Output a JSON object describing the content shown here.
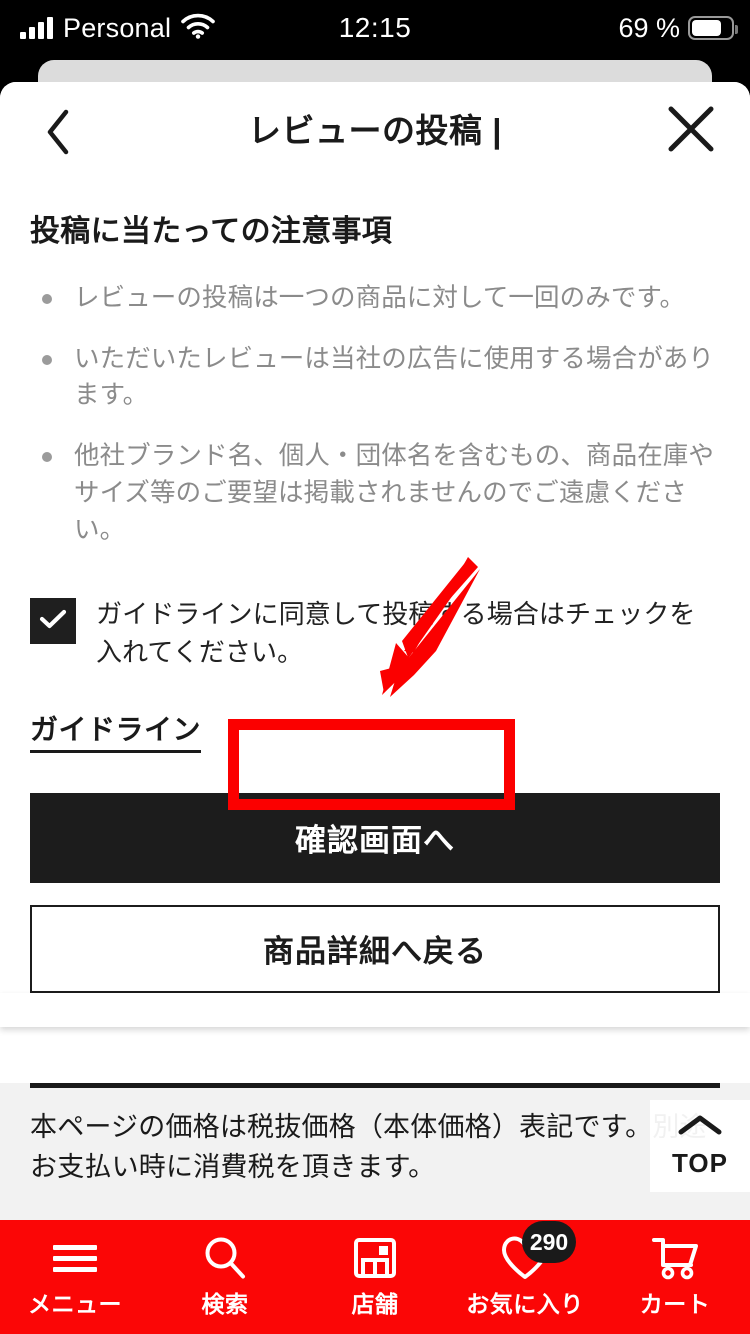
{
  "status_bar": {
    "carrier": "Personal",
    "time": "12:15",
    "battery_percent": "69 %",
    "signal_icon": "signal-bars-icon",
    "wifi_icon": "wifi-icon",
    "battery_icon": "battery-icon"
  },
  "header": {
    "title": "レビューの投稿 |",
    "back_icon": "chevron-left-icon",
    "close_icon": "close-x-icon"
  },
  "main": {
    "section_title": "投稿に当たっての注意事項",
    "notes": [
      "レビューの投稿は一つの商品に対して一回のみです。",
      "いただいたレビューは当社の広告に使用する場合があります。",
      "他社ブランド名、個人・団体名を含むもの、商品在庫やサイズ等のご要望は掲載されませんのでご遠慮ください。"
    ],
    "agreement": {
      "checked": true,
      "check_icon": "checkmark-icon",
      "label": "ガイドラインに同意して投稿する場合はチェックを入れてください。"
    },
    "guideline_link": "ガイドライン",
    "primary_button": "確認画面へ",
    "secondary_button": "商品詳細へ戻る"
  },
  "footer": {
    "note": "本ページの価格は税抜価格（本体価格）表記です。別途お支払い時に消費税を頂きます。",
    "top_button": {
      "label": "TOP",
      "icon": "chevron-up-icon"
    }
  },
  "bottom_nav": [
    {
      "label": "メニュー",
      "icon": "hamburger-menu-icon",
      "badge": null
    },
    {
      "label": "検索",
      "icon": "search-icon",
      "badge": null
    },
    {
      "label": "店舗",
      "icon": "store-icon",
      "badge": null
    },
    {
      "label": "お気に入り",
      "icon": "heart-icon",
      "badge": "290"
    },
    {
      "label": "カート",
      "icon": "cart-icon",
      "badge": null
    }
  ],
  "annotations": {
    "arrow_color": "#fb0000",
    "highlight_color": "#fb0000"
  },
  "colors": {
    "nav_red": "#fb0606",
    "button_black": "#1c1c1c",
    "footer_grey": "#f2f2f2"
  }
}
